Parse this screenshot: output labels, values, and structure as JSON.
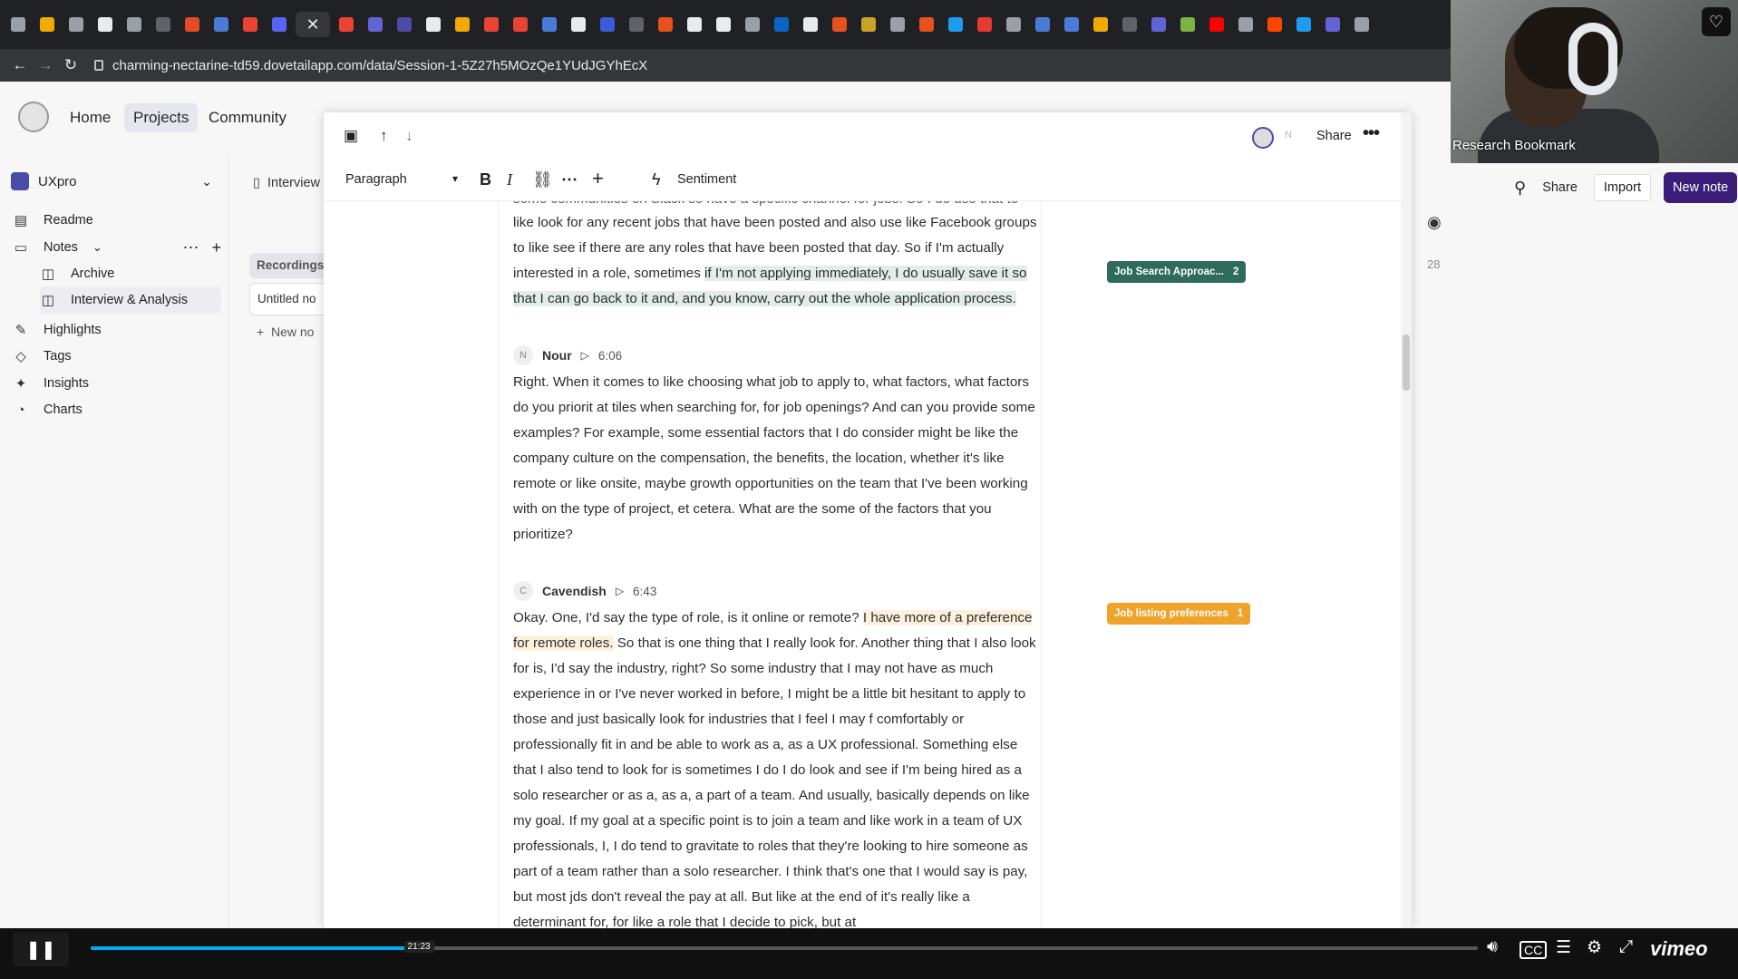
{
  "browser": {
    "url": "charming-nectarine-td59.dovetailapp.com/data/Session-1-5Z27h5MOzQe1YUdJGYhEcX",
    "tab_colors": [
      "#9aa0a6",
      "#f2a900",
      "#9aa0a6",
      "#e8eaed",
      "#9aa0a6",
      "#5f6368",
      "#e34c26",
      "#4a7bd8",
      "#ea4335",
      "#5865f2",
      "#e8eaed",
      "#ea4335",
      "#6264d6",
      "#4b4ba8",
      "#e8eaed",
      "#f2a900",
      "#ea4335",
      "#ea4335",
      "#4a7bd8",
      "#e8eaed",
      "#3b5bdb",
      "#5f6368",
      "#e8501e",
      "#e8eaed",
      "#e8eaed",
      "#9aa0a6",
      "#0a66c2",
      "#e8eaed",
      "#e8501e",
      "#c9a227",
      "#9aa0a6",
      "#e8501e",
      "#1d9bf0",
      "#e53935",
      "#9aa0a6",
      "#4a7bd8",
      "#4a7bd8",
      "#f2a900",
      "#5f6368",
      "#6264d6",
      "#7cb342",
      "#ff0000",
      "#9aa0a6",
      "#ff4500",
      "#1d9bf0",
      "#6264d6",
      "#9aa0a6"
    ]
  },
  "nav": {
    "home": "Home",
    "projects": "Projects",
    "community": "Community"
  },
  "workspace": {
    "name": "UXpro"
  },
  "sidebar": {
    "readme": "Readme",
    "notes": "Notes",
    "archive": "Archive",
    "interview": "Interview & Analysis",
    "highlights": "Highlights",
    "tags": "Tags",
    "insights": "Insights",
    "charts": "Charts"
  },
  "midcol": {
    "tab": "Interview",
    "recordings": "Recordings",
    "untitled": "Untitled no",
    "new_note": "New no"
  },
  "rightbar": {
    "share": "Share",
    "import": "Import",
    "new_note": "New note",
    "count": "28"
  },
  "modal": {
    "share": "Share",
    "avatar_initial": "N",
    "toolbar": {
      "paragraph": "Paragraph",
      "sentiment": "Sentiment"
    }
  },
  "transcript": {
    "top_cutoff": "some communities on Slack so have a specific channel for jobs. So I do use that to",
    "block1_plain": "like look for any recent jobs that have been posted and also use like Facebook groups to like see if there are any roles that have been posted that day. So if I'm actually interested in a role, sometimes ",
    "block1_highlight": "if I'm not applying immediately, I do usually save it so that I can go back to it and, and you know, carry out the whole application process.",
    "speaker1": {
      "initial": "N",
      "name": "Nour",
      "time": "6:06"
    },
    "block2": "Right. When it comes to like choosing what job to apply to, what factors, what factors do you priorit at tiles when searching for, for job openings? And can you provide some examples? For example, some essential factors that I do consider might be like the company culture on the compensation, the benefits, the location, whether it's like remote or like onsite, maybe growth opportunities on the team that I've been working with on the type of project, et cetera. What are the some of the factors that you prioritize?",
    "speaker2": {
      "initial": "C",
      "name": "Cavendish",
      "time": "6:43"
    },
    "block3_plain_a": "Okay. One, I'd say the type of role, is it online or remote? ",
    "block3_highlight": "I have more of a preference for remote roles.",
    "block3_plain_b": " So that is one thing that I really look for. Another thing that I also look for is, I'd say the industry, right? So some industry that I may not have as much experience in or I've never worked in before, I might be a little bit hesitant to apply to those and just basically look for industries that I feel I may f comfortably or professionally fit in and be able to work as a, as a UX professional. Something else that I also tend to look for is sometimes I do I do look and see if I'm being hired as a solo researcher or as a, as a, a part of a team. And usually, basically depends on like my goal. If my goal at a specific point is to join a team and like work in a team of UX professionals, I, I do tend to gravitate to roles that they're looking to hire someone as part of a team rather than a solo researcher. I think that's one that I would say is pay, but most jds don't reveal the pay at all. But like at the end of it's really like a determinant for, for like a role that I decide to pick, but at"
  },
  "tags": [
    {
      "label": "Job Search Approac...",
      "count": "2",
      "color": "#2e6b5a"
    },
    {
      "label": "Job listing preferences",
      "count": "1",
      "color": "#f0a32a"
    }
  ],
  "webcam": {
    "label": "Research Bookmark"
  },
  "player": {
    "time_tooltip": "21:23",
    "progress": 0.235,
    "brand": "vimeo"
  }
}
